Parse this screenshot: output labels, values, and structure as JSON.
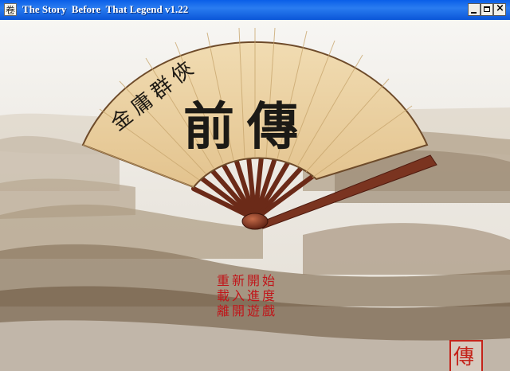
{
  "window": {
    "title": "The Story  Before  That Legend v1.22"
  },
  "titlebar": {
    "app_icon": "scroll-icon",
    "icon_glyph": "卷"
  },
  "fan": {
    "series_title": "金庸群俠",
    "main_title": "前傳"
  },
  "menu": {
    "items": [
      {
        "label": "重新開始"
      },
      {
        "label": "載入進度"
      },
      {
        "label": "離開遊戲"
      }
    ]
  },
  "seal": {
    "text": "傳"
  },
  "colors": {
    "titlebar": "#0a5fe8",
    "menu_text": "#c0161a",
    "fan_paper": "#ead2a5",
    "fan_wood": "#7a3420",
    "seal": "#c4231a"
  }
}
